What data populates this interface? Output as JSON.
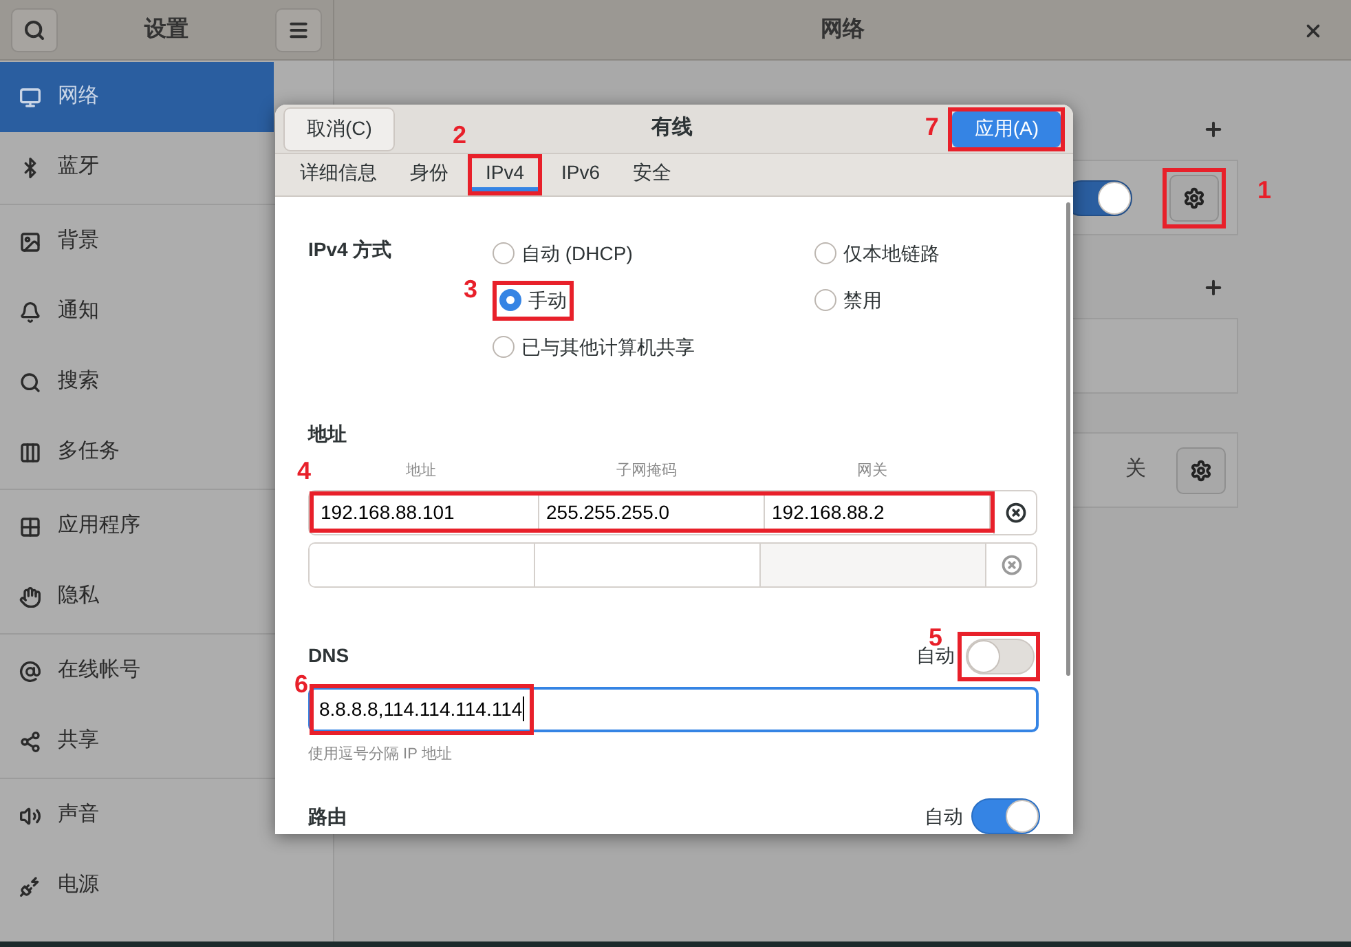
{
  "sidebar": {
    "title": "设置",
    "groups": [
      [
        {
          "label": "网络",
          "selected": true
        },
        {
          "label": "蓝牙",
          "selected": false
        }
      ],
      [
        {
          "label": "背景",
          "selected": false
        },
        {
          "label": "通知",
          "selected": false
        },
        {
          "label": "搜索",
          "selected": false
        },
        {
          "label": "多任务",
          "selected": false
        }
      ],
      [
        {
          "label": "应用程序",
          "selected": false
        },
        {
          "label": "隐私",
          "selected": false
        }
      ],
      [
        {
          "label": "在线帐号",
          "selected": false
        },
        {
          "label": "共享",
          "selected": false
        }
      ],
      [
        {
          "label": "声音",
          "selected": false
        },
        {
          "label": "电源",
          "selected": false
        }
      ]
    ]
  },
  "main": {
    "title": "网络",
    "cards": [
      {
        "kind": "switch",
        "on": true,
        "add_button": true
      },
      {
        "kind": "empty",
        "add_button": true
      },
      {
        "kind": "status",
        "status": "关",
        "add_button": false
      }
    ]
  },
  "dialog": {
    "title": "有线",
    "cancel": "取消(C)",
    "apply": "应用(A)",
    "tabs": [
      {
        "label": "详细信息",
        "selected": false
      },
      {
        "label": "身份",
        "selected": false
      },
      {
        "label": "IPv4",
        "selected": true
      },
      {
        "label": "IPv6",
        "selected": false
      },
      {
        "label": "安全",
        "selected": false
      }
    ],
    "method": {
      "label": "IPv4 方式",
      "options": [
        {
          "label": "自动 (DHCP)",
          "selected": false
        },
        {
          "label": "仅本地链路",
          "selected": false
        },
        {
          "label": "手动",
          "selected": true
        },
        {
          "label": "禁用",
          "selected": false
        },
        {
          "label": "已与其他计算机共享",
          "selected": false
        }
      ]
    },
    "addresses": {
      "title": "地址",
      "columns": [
        "地址",
        "子网掩码",
        "网关"
      ],
      "rows": [
        {
          "values": [
            "192.168.88.101",
            "255.255.255.0",
            "192.168.88.2"
          ],
          "disabled": false
        },
        {
          "disabled": true
        }
      ]
    },
    "dns": {
      "title": "DNS",
      "auto_label": "自动",
      "auto": false,
      "value": "8.8.8.8,114.114.114.114",
      "hint": "使用逗号分隔 IP 地址"
    },
    "routes": {
      "title": "路由",
      "auto_label": "自动",
      "auto": true
    }
  },
  "annotations": [
    {
      "label": "1"
    },
    {
      "label": "2"
    },
    {
      "label": "3"
    },
    {
      "label": "4"
    },
    {
      "label": "5"
    },
    {
      "label": "6"
    },
    {
      "label": "7"
    }
  ]
}
